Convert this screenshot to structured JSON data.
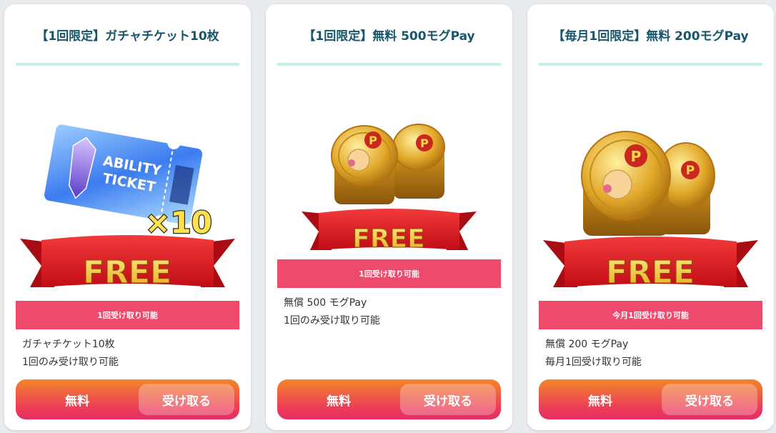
{
  "colors": {
    "title": "#17566a",
    "divider": "#c6eeea",
    "status_band": "#ed4a6c",
    "action_gradient_top": "#f3852a",
    "action_gradient_bottom": "#e52c63",
    "ribbon": "#e0141e",
    "free_text": "#f5c842"
  },
  "cards": [
    {
      "title": "【1回限定】ガチャチケット10枚",
      "image": {
        "type": "ability-ticket",
        "ticket_line1": "ABILITY",
        "ticket_line2": "TICKET",
        "multiplier": "×10",
        "badge": "FREE"
      },
      "status": "1回受け取り可能",
      "description": [
        "ガチャチケット10枚",
        "1回のみ受け取り可能"
      ],
      "price_label": "無料",
      "button_label": "受け取る"
    },
    {
      "title": "【1回限定】無料 500モグPay",
      "image": {
        "type": "moogle-coins-stack",
        "coin_letter": "P",
        "badge": "FREE"
      },
      "status": "1回受け取り可能",
      "description": [
        "無償 500 モグPay",
        "1回のみ受け取り可能"
      ],
      "price_label": "無料",
      "button_label": "受け取る"
    },
    {
      "title": "【毎月1回限定】無料 200モグPay",
      "image": {
        "type": "moogle-coins-pair",
        "coin_letter": "P",
        "badge": "FREE"
      },
      "status": "今月1回受け取り可能",
      "description": [
        "無償 200 モグPay",
        "毎月1回受け取り可能"
      ],
      "price_label": "無料",
      "button_label": "受け取る"
    }
  ]
}
